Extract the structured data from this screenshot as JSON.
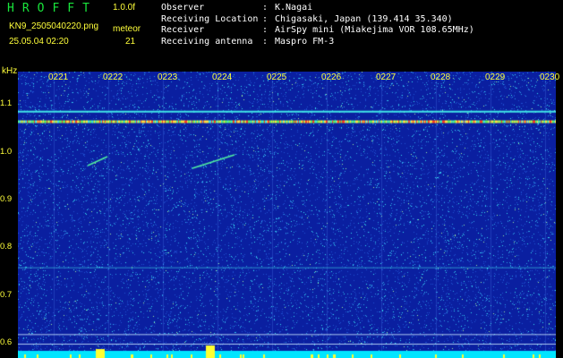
{
  "header": {
    "logo": "HROFFT",
    "version": "1.0.0f",
    "file_name": "KN9_2505040220.png",
    "timestamp": "25.05.04 02:20",
    "meteor_label": "meteor",
    "meteor_count": "21"
  },
  "info": [
    {
      "key": "Observer",
      "value": "K.Nagai"
    },
    {
      "key": "Receiving Location",
      "value": "Chigasaki, Japan (139.414 35.340)"
    },
    {
      "key": "Receiver",
      "value": "AirSpy mini (Miakejima VOR 108.65MHz)"
    },
    {
      "key": "Receiving antenna",
      "value": "Maspro FM-3"
    }
  ],
  "chart_data": {
    "type": "heatmap",
    "ylabel": "kHz",
    "y_ticks": [
      "1.1",
      "1.0",
      "0.9",
      "0.8",
      "0.7",
      "0.6"
    ],
    "y_tick_values": [
      1.1,
      1.0,
      0.9,
      0.8,
      0.7,
      0.6
    ],
    "ylim": [
      0.57,
      1.17
    ],
    "x_ticks": [
      "0221",
      "0222",
      "0223",
      "0224",
      "0225",
      "0226",
      "0227",
      "0228",
      "0229",
      "0230"
    ],
    "carriers_khz": [
      1.088,
      1.066,
      0.76,
      0.62,
      0.6
    ],
    "meteor_traces": [
      {
        "time": "0221",
        "freq_start": 0.99,
        "freq_end": 1.01
      },
      {
        "time": "0223",
        "freq_start": 0.985,
        "freq_end": 1.01
      }
    ],
    "background_color": "#0a1fa0",
    "noise_color": "#00e5ff"
  }
}
